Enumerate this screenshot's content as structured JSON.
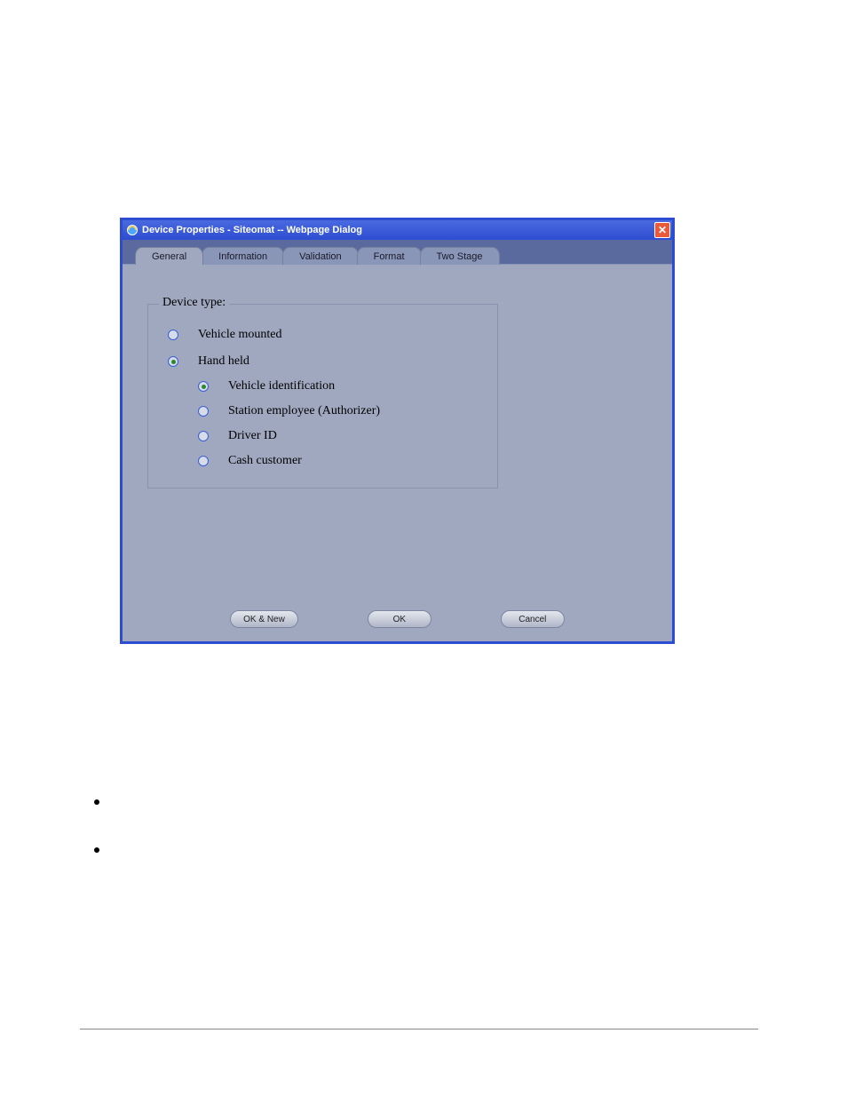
{
  "dialog": {
    "title": "Device Properties - Siteomat -- Webpage Dialog",
    "tabs": [
      {
        "label": "General",
        "active": true
      },
      {
        "label": "Information",
        "active": false
      },
      {
        "label": "Validation",
        "active": false
      },
      {
        "label": "Format",
        "active": false
      },
      {
        "label": "Two Stage",
        "active": false
      }
    ],
    "group": {
      "legend": "Device type:",
      "options": [
        {
          "label": "Vehicle mounted",
          "selected": false
        },
        {
          "label": "Hand held",
          "selected": true
        }
      ],
      "sub_options": [
        {
          "label": "Vehicle identification",
          "selected": true
        },
        {
          "label": "Station employee (Authorizer)",
          "selected": false
        },
        {
          "label": "Driver ID",
          "selected": false
        },
        {
          "label": "Cash customer",
          "selected": false
        }
      ]
    },
    "buttons": {
      "ok_new": "OK & New",
      "ok": "OK",
      "cancel": "Cancel"
    }
  }
}
